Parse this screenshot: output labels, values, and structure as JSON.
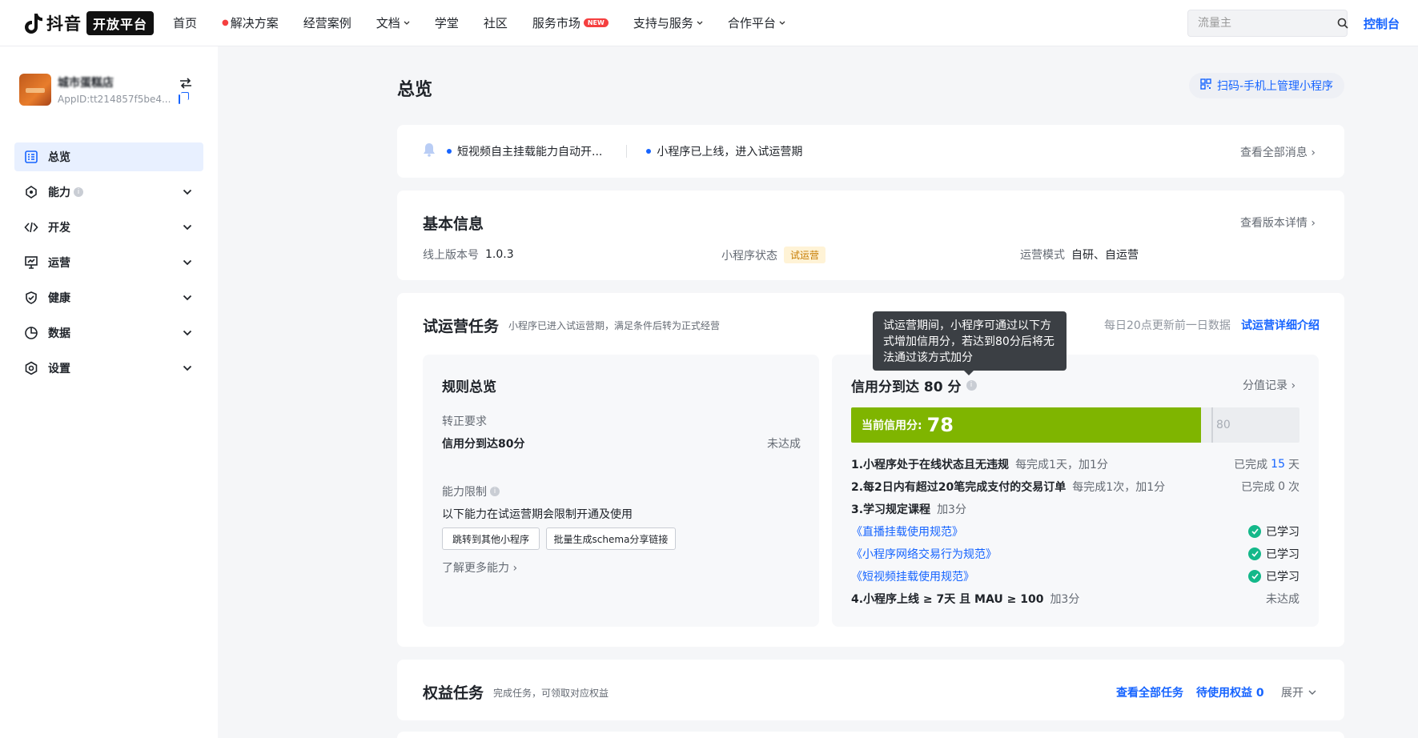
{
  "header": {
    "logo_text": "抖音",
    "logo_badge": "开放平台",
    "nav": [
      {
        "label": "首页",
        "has_chevron": false,
        "hot": false,
        "new": false
      },
      {
        "label": "解决方案",
        "has_chevron": false,
        "hot": true,
        "new": false
      },
      {
        "label": "经营案例",
        "has_chevron": false,
        "hot": false,
        "new": false
      },
      {
        "label": "文档",
        "has_chevron": true,
        "hot": false,
        "new": false
      },
      {
        "label": "学堂",
        "has_chevron": false,
        "hot": false,
        "new": false
      },
      {
        "label": "社区",
        "has_chevron": false,
        "hot": false,
        "new": false
      },
      {
        "label": "服务市场",
        "has_chevron": false,
        "hot": false,
        "new": true
      },
      {
        "label": "支持与服务",
        "has_chevron": true,
        "hot": false,
        "new": false
      },
      {
        "label": "合作平台",
        "has_chevron": true,
        "hot": false,
        "new": false
      }
    ],
    "new_badge": "NEW",
    "search_placeholder": "流量主",
    "console_link": "控制台"
  },
  "sidebar": {
    "app_name": "城市蛋糕店",
    "app_id": "AppID:tt214857f5be4...",
    "menu": [
      {
        "label": "总览",
        "icon": "dashboard-icon",
        "active": true,
        "has_chevron": false,
        "has_info": false
      },
      {
        "label": "能力",
        "icon": "capability-icon",
        "active": false,
        "has_chevron": true,
        "has_info": true
      },
      {
        "label": "开发",
        "icon": "code-icon",
        "active": false,
        "has_chevron": true,
        "has_info": false
      },
      {
        "label": "运营",
        "icon": "operation-icon",
        "active": false,
        "has_chevron": true,
        "has_info": false
      },
      {
        "label": "健康",
        "icon": "health-icon",
        "active": false,
        "has_chevron": true,
        "has_info": false
      },
      {
        "label": "数据",
        "icon": "chart-icon",
        "active": false,
        "has_chevron": true,
        "has_info": false
      },
      {
        "label": "设置",
        "icon": "settings-icon",
        "active": false,
        "has_chevron": true,
        "has_info": false
      }
    ]
  },
  "main": {
    "title": "总览",
    "scan_button": "扫码-手机上管理小程序",
    "notices": {
      "items": [
        "短视频自主挂载能力自动开...",
        "小程序已上线，进入试运营期"
      ],
      "view_all": "查看全部消息"
    },
    "basic_info": {
      "title": "基本信息",
      "view_version": "查看版本详情",
      "version_label": "线上版本号",
      "version_value": "1.0.3",
      "status_label": "小程序状态",
      "status_tag": "试运营",
      "mode_label": "运营模式",
      "mode_value": "自研、自运营"
    },
    "trial": {
      "title": "试运营任务",
      "desc": "小程序已进入试运营期，满足条件后转为正式经营",
      "update_note": "每日20点更新前一日数据",
      "detail_link": "试运营详细介绍",
      "rules": {
        "title": "规则总览",
        "requirement_label": "转正要求",
        "requirement": "信用分到达80分",
        "requirement_status": "未达成",
        "limit_label": "能力限制",
        "limit_desc": "以下能力在试运营期会限制开通及使用",
        "buttons": [
          "跳转到其他小程序",
          "批量生成schema分享链接"
        ],
        "more_link": "了解更多能力"
      },
      "credit": {
        "title": "信用分到达 80 分",
        "record_link": "分值记录",
        "current_label": "当前信用分:",
        "current_score": 78,
        "target_score": 80,
        "max_score": 100,
        "tooltip": "试运营期间，小程序可通过以下方式增加信用分，若达到80分后将无法通过该方式加分",
        "tasks": [
          {
            "main": "1.小程序处于在线状态且无违规",
            "sub": "每完成1天，加1分",
            "status_prefix": "已完成",
            "status_value": "15",
            "status_suffix": "天"
          },
          {
            "main": "2.每2日内有超过20笔完成支付的交易订单",
            "sub": "每完成1次，加1分",
            "status_prefix": "已完成",
            "status_value": "0",
            "status_suffix": "次"
          },
          {
            "main": "3.学习规定课程",
            "sub": "加3分"
          }
        ],
        "courses": [
          {
            "name": "《直播挂载使用规范》",
            "status": "已学习"
          },
          {
            "name": "《小程序网络交易行为规范》",
            "status": "已学习"
          },
          {
            "name": "《短视频挂载使用规范》",
            "status": "已学习"
          }
        ],
        "task4": {
          "main": "4.小程序上线 ≥ 7天 且 MAU ≥ 100",
          "sub": "加3分",
          "status": "未达成"
        }
      }
    },
    "rights": {
      "title": "权益任务",
      "desc": "完成任务，可领取对应权益",
      "view_all": "查看全部任务",
      "pending_label": "待使用权益",
      "pending_count": "0",
      "expand": "展开"
    }
  }
}
